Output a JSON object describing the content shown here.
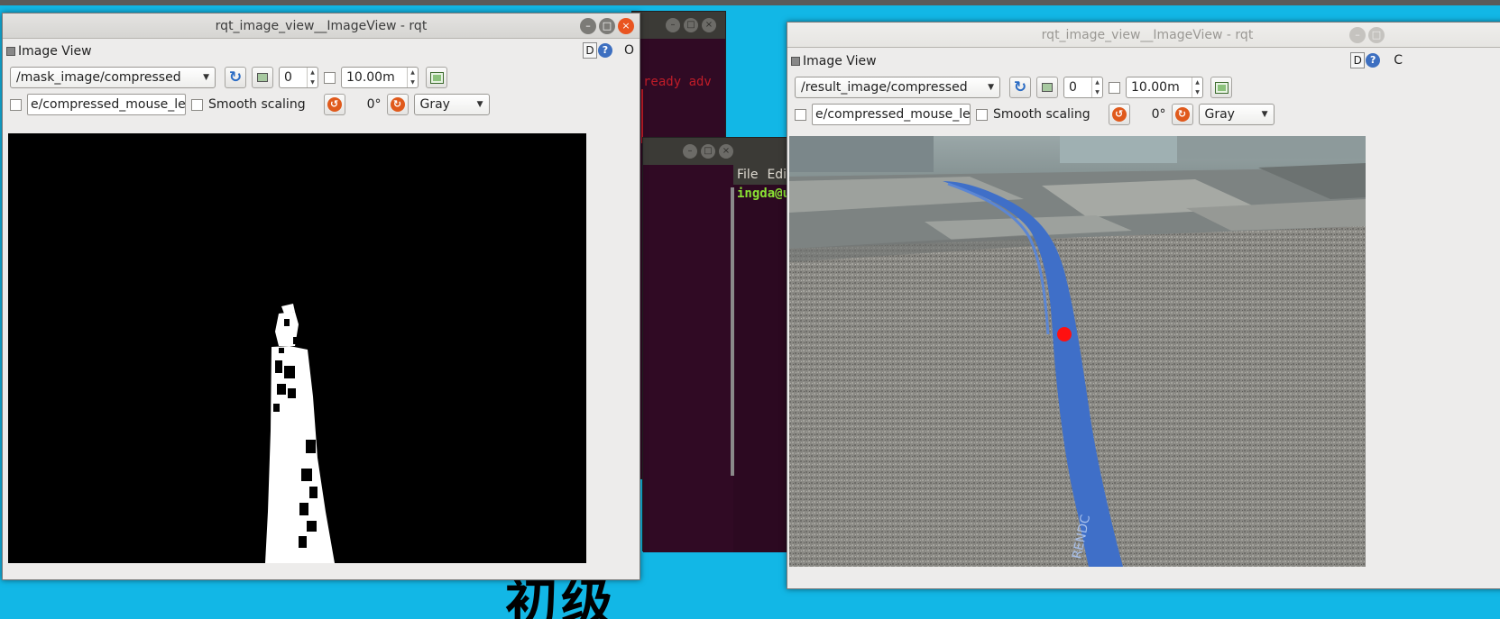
{
  "desktop": {
    "big_text": "初级",
    "background_color": "#12b7e6"
  },
  "terminal_back": {
    "red_text": "ready adv",
    "menu": [
      "File",
      "Edit"
    ],
    "prompt": "ingda@u"
  },
  "left_window": {
    "title": "rqt_image_view__ImageView - rqt",
    "pane_title": "Image View",
    "help_label": "D",
    "help_icon": "?",
    "pane_close": "O",
    "topic": "/mask_image/compressed",
    "frame_value": "0",
    "timeout_value": "10.00m",
    "mouse_topic": "e/compressed_mouse_left",
    "smooth_label": "Smooth scaling",
    "rotation": "0°",
    "color_scheme": "Gray"
  },
  "right_window": {
    "title": "rqt_image_view__ImageView - rqt",
    "pane_title": "Image View",
    "help_label": "D",
    "help_icon": "?",
    "pane_close": "C",
    "topic": "/result_image/compressed",
    "frame_value": "0",
    "timeout_value": "10.00m",
    "mouse_topic": "e/compressed_mouse_left",
    "smooth_label": "Smooth scaling",
    "rotation": "0°",
    "color_scheme": "Gray",
    "tape_text": "RENDC"
  },
  "icons": {
    "refresh": "refresh-icon",
    "zoom": "zoom-1-icon",
    "save": "save-image-icon",
    "rotate_left": "rotate-left-icon",
    "rotate_right": "rotate-right-icon"
  },
  "colors": {
    "ubuntu_orange": "#e95420",
    "terminal_bg": "#300a24",
    "tape_blue": "#3f6fc8",
    "target_dot": "#ff1010"
  }
}
